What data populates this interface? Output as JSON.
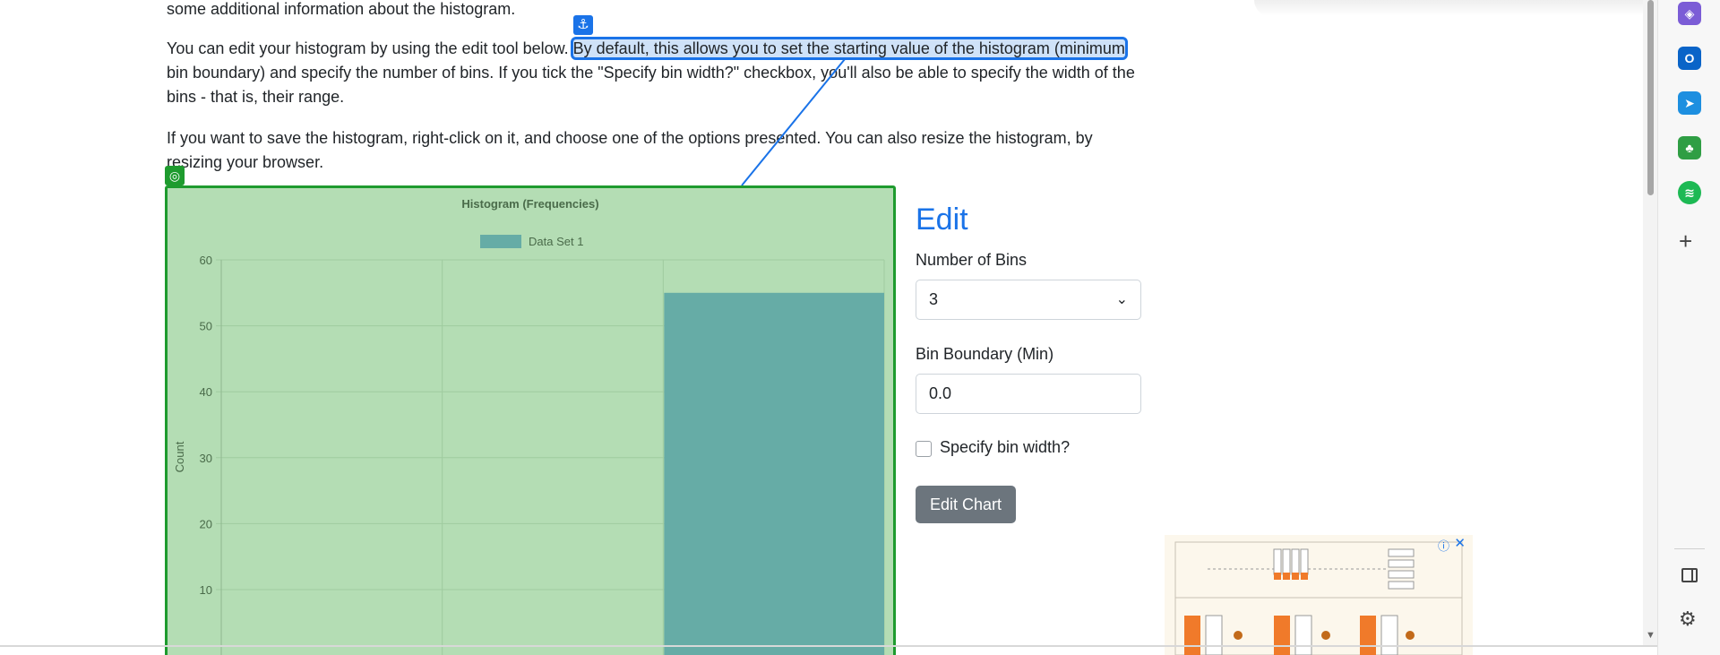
{
  "article": {
    "p0": "some additional information about the histogram.",
    "p1_before": "You can edit your histogram by using the edit tool below.",
    "p1_highlight": "By default, this allows you to set the starting value of the histogram (minimum",
    "p1_after": "bin boundary) and specify the number of bins. If you tick the \"Specify bin width?\" checkbox, you'll also be able to specify the width of the bins - that is, their range.",
    "p2": "If you want to save the histogram, right-click on it, and choose one of the options presented. You can also resize the histogram, by resizing your browser."
  },
  "badges": {
    "anchor_icon": "anchor-icon",
    "target_icon": "target-icon"
  },
  "chart_data": {
    "type": "bar",
    "title": "Histogram (Frequencies)",
    "ylabel": "Count",
    "xlabel": "",
    "legend": "Data Set 1",
    "legend_position": "top",
    "series": [
      {
        "name": "Data Set 1",
        "values": [
          0,
          0,
          55
        ]
      }
    ],
    "y_ticks": [
      "60",
      "50",
      "40",
      "30",
      "20",
      "10"
    ],
    "ylim": [
      0,
      60
    ],
    "bins": 3,
    "grid": true,
    "colors": {
      "bar": "#66aca6",
      "background": "#b4ddb4",
      "grid": "#9fcb9f"
    }
  },
  "edit": {
    "title": "Edit",
    "bins_label": "Number of Bins",
    "bins_value": "3",
    "boundary_label": "Bin Boundary (Min)",
    "boundary_value": "0.0",
    "checkbox_label": "Specify bin width?",
    "button_label": "Edit Chart"
  },
  "ad": {
    "info_icon": "info-icon",
    "close_icon": "close-icon"
  },
  "sidebar": {
    "items": [
      {
        "name": "copilot-icon",
        "color": "#7b5cd6"
      },
      {
        "name": "outlook-icon",
        "color": "#0a64c8"
      },
      {
        "name": "send-icon",
        "color": "#1d8fe0"
      },
      {
        "name": "tree-icon",
        "color": "#2f9e44"
      },
      {
        "name": "spotify-icon",
        "color": "#1db954"
      }
    ],
    "add_icon": "plus-icon",
    "panel_icon": "sidebar-panel-icon",
    "settings_icon": "gear-icon"
  },
  "colors": {
    "accent": "#1a73e8",
    "highlight_fill": "#cfe2f8",
    "chart_frame": "#1e9b2e",
    "button": "#6c757d"
  }
}
